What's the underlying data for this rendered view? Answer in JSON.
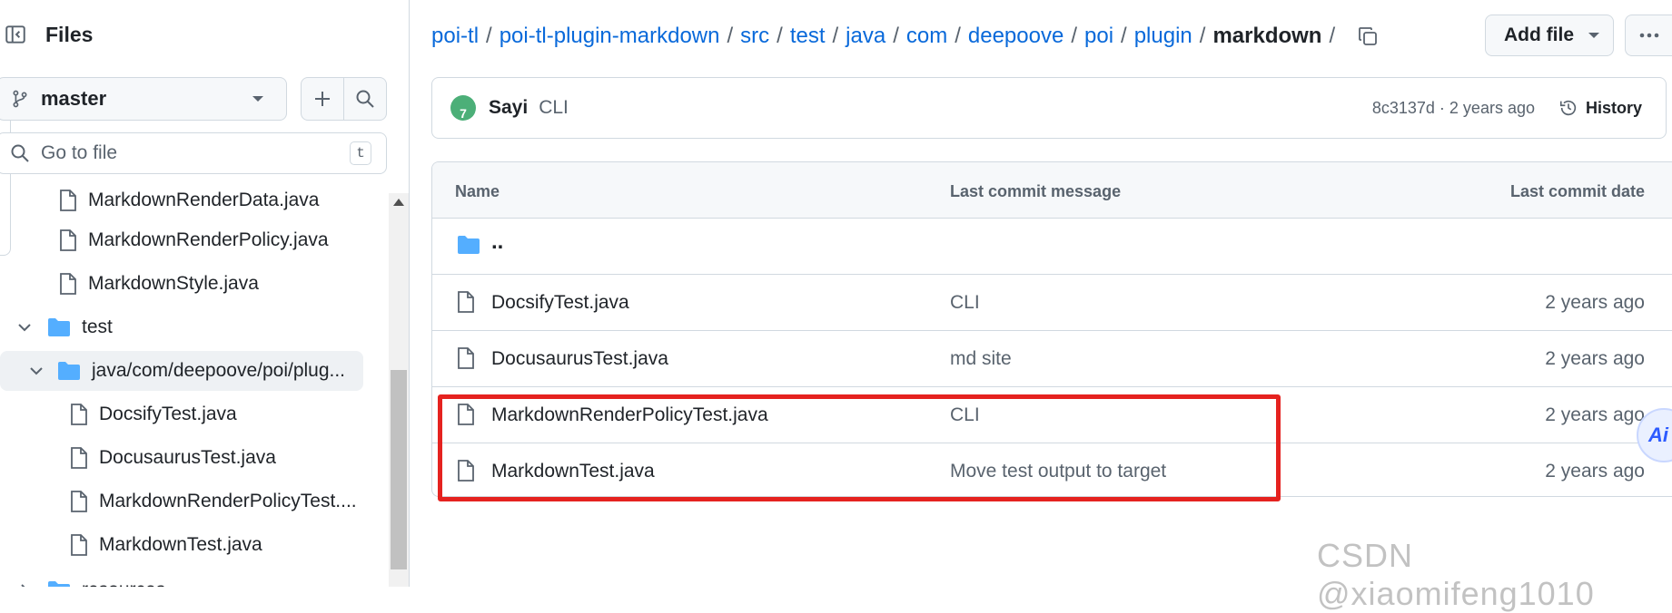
{
  "sidebar": {
    "title": "Files",
    "branch": "master",
    "goto_placeholder": "Go to file",
    "goto_shortcut": "t",
    "tree": [
      {
        "label": "MarkdownRenderData.java",
        "type": "file"
      },
      {
        "label": "MarkdownRenderPolicy.java",
        "type": "file"
      },
      {
        "label": "MarkdownStyle.java",
        "type": "file"
      },
      {
        "label": "test",
        "type": "folder",
        "expanded": true
      },
      {
        "label": "java/com/deepoove/poi/plug...",
        "type": "folder",
        "expanded": true,
        "active": true
      },
      {
        "label": "DocsifyTest.java",
        "type": "file"
      },
      {
        "label": "DocusaurusTest.java",
        "type": "file"
      },
      {
        "label": "MarkdownRenderPolicyTest....",
        "type": "file"
      },
      {
        "label": "MarkdownTest.java",
        "type": "file"
      },
      {
        "label": "resources",
        "type": "folder"
      }
    ]
  },
  "breadcrumb": {
    "segments": [
      "poi-tl",
      "poi-tl-plugin-markdown",
      "src",
      "test",
      "java",
      "com",
      "deepoove",
      "poi",
      "plugin"
    ],
    "current": "markdown",
    "separator": "/"
  },
  "toolbar": {
    "add_file": "Add file"
  },
  "commit": {
    "author": "Sayi",
    "avatar_letter": "7",
    "message": "CLI",
    "meta": "8c3137d · 2 years ago",
    "history_label": "History"
  },
  "table": {
    "headers": {
      "name": "Name",
      "message": "Last commit message",
      "date": "Last commit date"
    },
    "parent": "..",
    "rows": [
      {
        "name": "DocsifyTest.java",
        "message": "CLI",
        "date": "2 years ago"
      },
      {
        "name": "DocusaurusTest.java",
        "message": "md site",
        "date": "2 years ago"
      },
      {
        "name": "MarkdownRenderPolicyTest.java",
        "message": "CLI",
        "date": "2 years ago"
      },
      {
        "name": "MarkdownTest.java",
        "message": "Move test output to target",
        "date": "2 years ago"
      }
    ]
  },
  "overlay": {
    "ai_label": "Ai",
    "watermark": "CSDN @xiaomifeng1010",
    "highlight_color": "#e5221f"
  },
  "colors": {
    "link": "#0969da",
    "folder": "#54aeff",
    "muted": "#59636e",
    "border": "#d1d9e0"
  }
}
